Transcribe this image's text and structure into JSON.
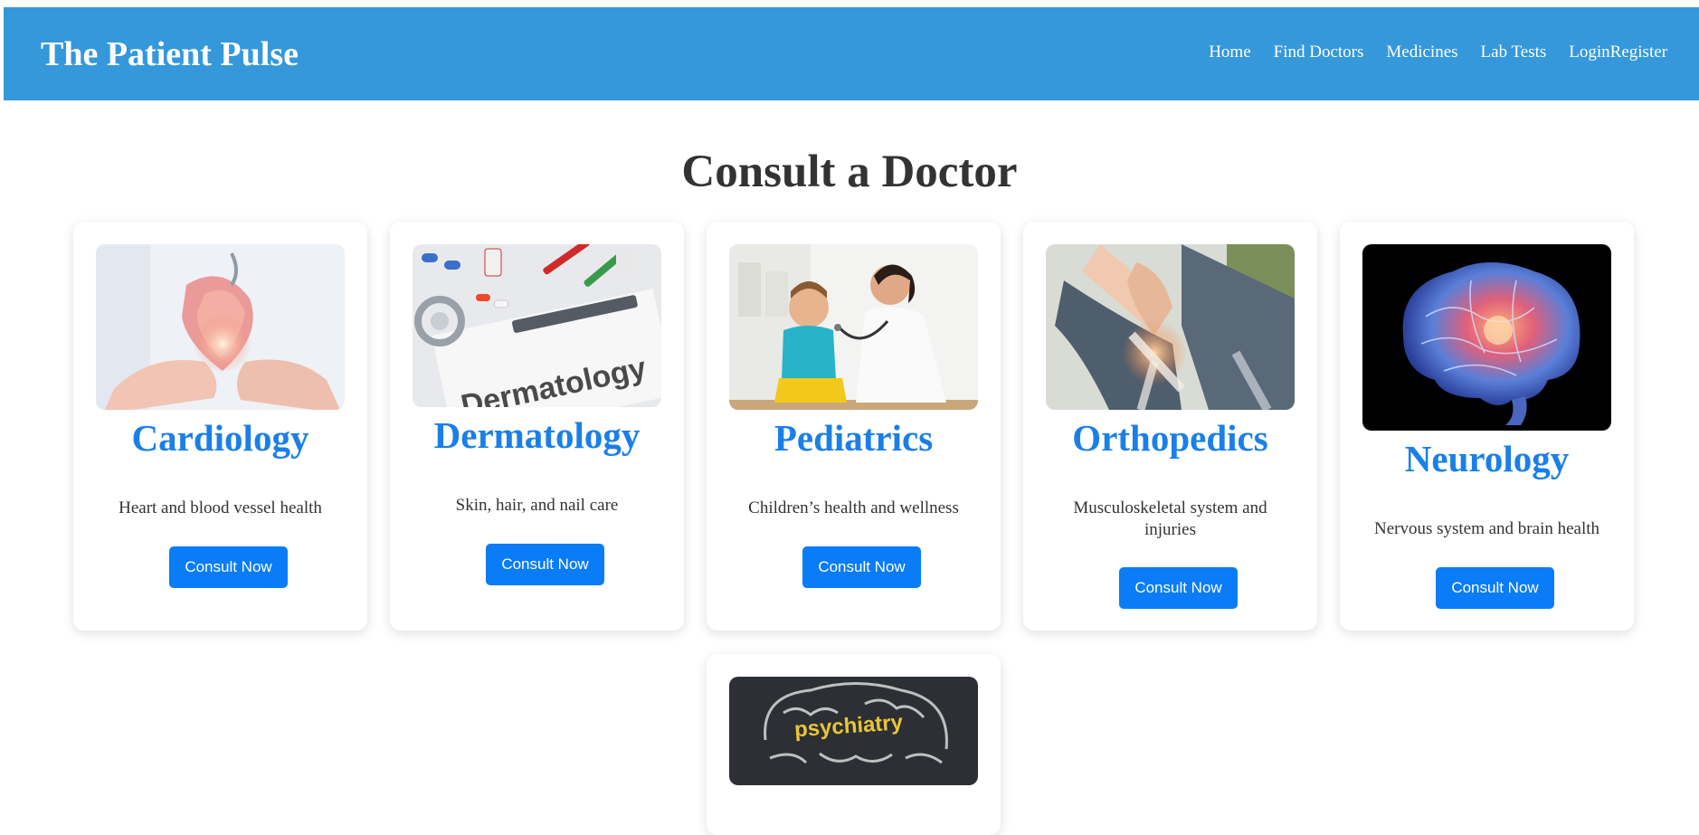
{
  "header": {
    "brand": "The Patient Pulse",
    "nav": [
      "Home",
      "Find Doctors",
      "Medicines",
      "Lab Tests"
    ],
    "login": "Login",
    "register": "Register"
  },
  "main": {
    "title": "Consult a Doctor",
    "cards": [
      {
        "title": "Cardiology",
        "desc": "Heart and blood vessel health",
        "button": "Consult Now",
        "image": "heart-in-hands"
      },
      {
        "title": "Dermatology",
        "desc": "Skin, hair, and nail care",
        "button": "Consult Now",
        "image": "dermatology-clipboard",
        "image_text": "Dermatology"
      },
      {
        "title": "Pediatrics",
        "desc": "Children’s health and wellness",
        "button": "Consult Now",
        "image": "doctor-with-child"
      },
      {
        "title": "Orthopedics",
        "desc": "Musculoskeletal system and injuries",
        "button": "Consult Now",
        "image": "knee-xray"
      },
      {
        "title": "Neurology",
        "desc": "Nervous system and brain health",
        "button": "Consult Now",
        "image": "glowing-brain"
      },
      {
        "title": "",
        "desc": "",
        "button": "",
        "image": "chalk-brain",
        "image_text": "psychiatry"
      }
    ]
  },
  "colors": {
    "navbar": "#3498db",
    "accent": "#1a7fe8",
    "button": "#0a7cf7",
    "text": "#333333"
  }
}
